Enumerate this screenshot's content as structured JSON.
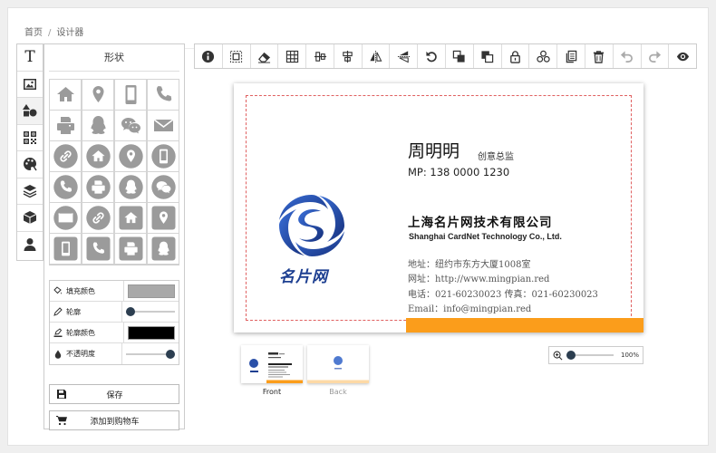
{
  "breadcrumb": {
    "home": "首页",
    "separator": "/",
    "current": "设计器"
  },
  "left_tabs": [
    {
      "name": "text-tab",
      "icon": "text-icon"
    },
    {
      "name": "image-tab",
      "icon": "image-icon"
    },
    {
      "name": "shapes-tab",
      "icon": "shapes-icon",
      "active": true
    },
    {
      "name": "qrcode-tab",
      "icon": "qrcode-icon"
    },
    {
      "name": "background-tab",
      "icon": "palette-icon"
    },
    {
      "name": "layers-tab",
      "icon": "layers-icon"
    },
    {
      "name": "template-tab",
      "icon": "box-icon"
    },
    {
      "name": "user-tab",
      "icon": "user-icon"
    }
  ],
  "panel": {
    "title": "形状",
    "shapes": [
      "home-icon",
      "map-marker-icon",
      "mobile-icon",
      "phone-icon",
      "fax-icon",
      "qq-icon",
      "wechat-icon",
      "envelope-icon",
      "link-circle-icon",
      "home-circle-icon",
      "map-marker-circle-icon",
      "mobile-circle-icon",
      "phone-circle-icon",
      "fax-circle-icon",
      "qq-circle-icon",
      "wechat-circle-icon",
      "envelope-circle-icon",
      "link-circle-icon",
      "home-square-icon",
      "map-marker-square-icon",
      "mobile-square-icon",
      "phone-square-icon",
      "fax-square-icon",
      "qq-square-icon"
    ],
    "fill_color_label": "填充颜色",
    "fill_color": "#a9a9a9",
    "outline_label": "轮廓",
    "outline_value": 0,
    "outline_color_label": "轮廓颜色",
    "outline_color": "#000000",
    "opacity_label": "不透明度",
    "opacity_value": 1,
    "save_label": "保存",
    "add_cart_label": "添加到购物车"
  },
  "toolbar": [
    "info-icon",
    "select-icon",
    "eraser-icon",
    "grid-icon",
    "align-vertical-icon",
    "align-horizontal-icon",
    "flip-horizontal-icon",
    "flip-vertical-icon",
    "undo-rotate-icon",
    "bring-front-icon",
    "send-back-icon",
    "lock-icon",
    "group-icon",
    "copy-icon",
    "trash-icon",
    "undo-icon",
    "redo-icon",
    "preview-icon"
  ],
  "card": {
    "name": "周明明",
    "title": "创意总监",
    "mp": "MP: 138 0000 1230",
    "company_cn": "上海名片网技术有限公司",
    "company_en": "Shanghai CardNet Technology Co., Ltd.",
    "address": "地址：纽约市东方大厦1008室",
    "website": "网址：http://www.mingpian.red",
    "phone": "电话：021-60230023  传真：021-60230023",
    "email": "Email：info@mingpian.red",
    "logo_text": "名片网",
    "accent_color": "#fb9d1b",
    "logo_color": "#1d3f91"
  },
  "thumbs": {
    "front_label": "Front",
    "back_label": "Back"
  },
  "zoom": {
    "level_label": "100%",
    "level": 1.0
  }
}
